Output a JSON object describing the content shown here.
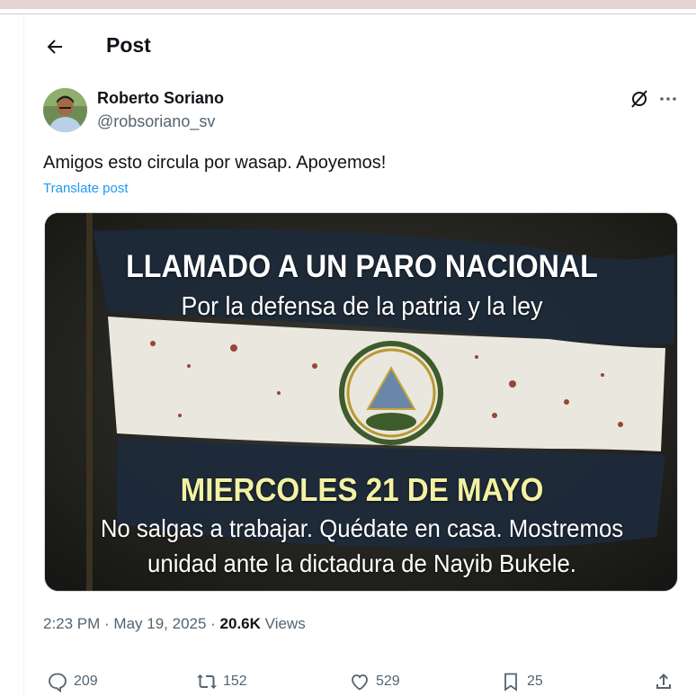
{
  "header": {
    "title": "Post"
  },
  "author": {
    "name": "Roberto Soriano",
    "handle": "@robsoriano_sv"
  },
  "post": {
    "text": "Amigos esto circula por wasap. Apoyemos!",
    "translate_label": "Translate post"
  },
  "media": {
    "headline": "LLAMADO A UN PARO NACIONAL",
    "subheadline": "Por la defensa de la patria y la ley",
    "date_line": "MIERCOLES 21 DE MAYO",
    "body_line1": "No salgas a trabajar. Quédate en casa. Mostremos",
    "body_line2": "unidad ante la dictadura de Nayib Bukele.",
    "colors": {
      "date_text": "#f4f2a2",
      "flag_blue": "#1d2a3a",
      "flag_white": "#e9e7de"
    }
  },
  "meta": {
    "time": "2:23 PM",
    "separator": " · ",
    "date": "May 19, 2025",
    "views_count": "20.6K",
    "views_label": "Views"
  },
  "actions": {
    "replies": "209",
    "reposts": "152",
    "likes": "529",
    "bookmarks": "25"
  },
  "icons": [
    "back-arrow-icon",
    "grok-icon",
    "more-icon",
    "reply-icon",
    "repost-icon",
    "like-icon",
    "bookmark-icon",
    "share-icon"
  ],
  "colors": {
    "link": "#1d9bf0",
    "secondary_text": "#536471",
    "primary_text": "#0f1419"
  }
}
